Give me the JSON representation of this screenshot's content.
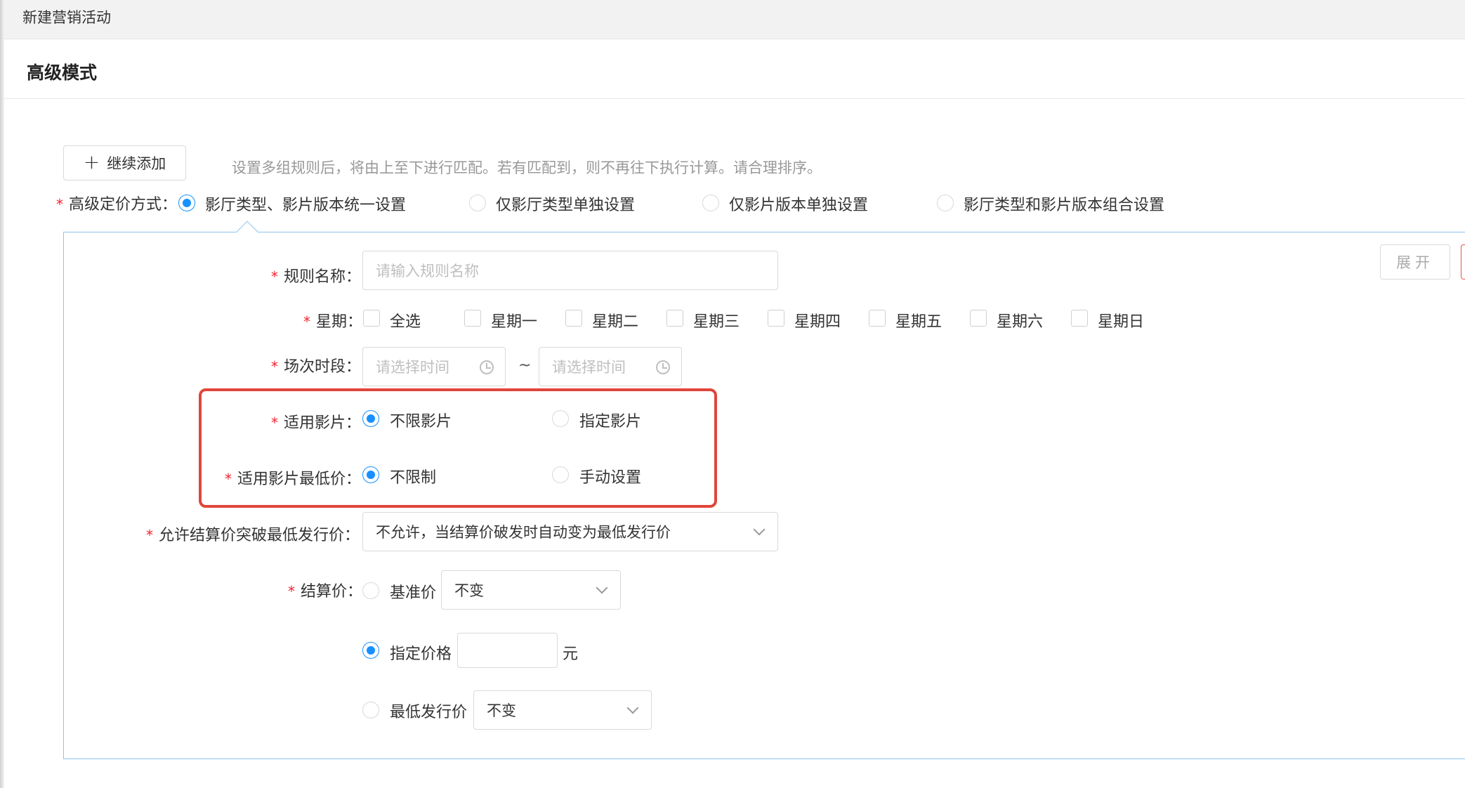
{
  "window": {
    "title": "新建营销活动"
  },
  "section": {
    "title": "高级模式"
  },
  "toolbar": {
    "add_label": "继续添加",
    "hint": "设置多组规则后，将由上至下进行匹配。若有匹配到，则不再往下执行计算。请合理排序。"
  },
  "pricing_mode": {
    "label": "高级定价方式：",
    "options": [
      {
        "label": "影厅类型、影片版本统一设置",
        "selected": true
      },
      {
        "label": "仅影厅类型单独设置",
        "selected": false
      },
      {
        "label": "仅影片版本单独设置",
        "selected": false
      },
      {
        "label": "影厅类型和影片版本组合设置",
        "selected": false
      }
    ]
  },
  "rule": {
    "expand_label": "展开",
    "name": {
      "label": "规则名称：",
      "placeholder": "请输入规则名称"
    },
    "week": {
      "label": "星期：",
      "options": [
        "全选",
        "星期一",
        "星期二",
        "星期三",
        "星期四",
        "星期五",
        "星期六",
        "星期日"
      ]
    },
    "session": {
      "label": "场次时段：",
      "start_placeholder": "请选择时间",
      "end_placeholder": "请选择时间",
      "separator": "~"
    },
    "film": {
      "label": "适用影片：",
      "options": [
        {
          "label": "不限影片",
          "selected": true
        },
        {
          "label": "指定影片",
          "selected": false
        }
      ]
    },
    "min_price": {
      "label": "适用影片最低价：",
      "options": [
        {
          "label": "不限制",
          "selected": true
        },
        {
          "label": "手动设置",
          "selected": false
        }
      ]
    },
    "break_min": {
      "label": "允许结算价突破最低发行价：",
      "value": "不允许，当结算价破发时自动变为最低发行价"
    },
    "settle": {
      "label": "结算价：",
      "base": {
        "label": "基准价",
        "select_value": "不变",
        "selected": false
      },
      "fixed": {
        "label": "指定价格",
        "value": "",
        "unit": "元",
        "selected": true
      },
      "min_issue": {
        "label": "最低发行价",
        "select_value": "不变",
        "selected": false
      }
    }
  },
  "colors": {
    "accent": "#1890ff",
    "required": "#f5222d",
    "highlight": "#e0463b",
    "panel_border": "#8cc4ef"
  }
}
